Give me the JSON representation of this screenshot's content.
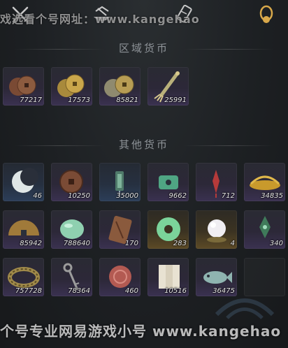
{
  "watermark_top": "戏选看个号网址：www.kangehao",
  "watermark_bottom": "个号专业网易游戏小号 www.kangehao",
  "tabs": [
    {
      "name": "crossed-swords-icon"
    },
    {
      "name": "mountain-bowl-icon"
    },
    {
      "name": "scroll-icon"
    },
    {
      "name": "gold-coin-tab-icon",
      "active": true
    }
  ],
  "sections": {
    "regional": {
      "title": "区域货币",
      "items": [
        {
          "icon": "copper-coins-icon",
          "count": "77217",
          "rarity": "purple"
        },
        {
          "icon": "gold-coins-icon",
          "count": "17573",
          "rarity": "purple"
        },
        {
          "icon": "silver-gold-coins-icon",
          "count": "85821",
          "rarity": "purple"
        },
        {
          "icon": "tassel-ornament-icon",
          "count": "25991",
          "rarity": "purple"
        }
      ]
    },
    "other": {
      "title": "其他货币",
      "items": [
        {
          "icon": "crescent-jade-icon",
          "count": "46",
          "rarity": "blue"
        },
        {
          "icon": "bronze-coin-icon",
          "count": "10250",
          "rarity": "purple"
        },
        {
          "icon": "jade-token-icon",
          "count": "35000",
          "rarity": "blue"
        },
        {
          "icon": "green-jade-pendant-icon",
          "count": "9662",
          "rarity": "purple"
        },
        {
          "icon": "red-knot-icon",
          "count": "712",
          "rarity": "purple"
        },
        {
          "icon": "golden-millet-icon",
          "count": "34835",
          "rarity": "purple"
        },
        {
          "icon": "bronze-half-disc-icon",
          "count": "85942",
          "rarity": "purple"
        },
        {
          "icon": "jade-pebble-icon",
          "count": "788640",
          "rarity": "purple"
        },
        {
          "icon": "bronze-tablet-icon",
          "count": "170",
          "rarity": "purple"
        },
        {
          "icon": "jade-bi-disc-icon",
          "count": "283",
          "rarity": "gold"
        },
        {
          "icon": "pearl-icon",
          "count": "4",
          "rarity": "gold"
        },
        {
          "icon": "jade-pendant-knot-icon",
          "count": "340",
          "rarity": "purple"
        },
        {
          "icon": "bronze-bracelet-icon",
          "count": "757728",
          "rarity": "purple"
        },
        {
          "icon": "antique-key-icon",
          "count": "78364",
          "rarity": "purple"
        },
        {
          "icon": "cinnabar-ball-icon",
          "count": "460",
          "rarity": "purple"
        },
        {
          "icon": "paper-notes-icon",
          "count": "10516",
          "rarity": "purple"
        },
        {
          "icon": "jade-fish-icon",
          "count": "36475",
          "rarity": "purple"
        },
        {
          "icon": "",
          "count": "",
          "rarity": "empty"
        }
      ]
    }
  }
}
